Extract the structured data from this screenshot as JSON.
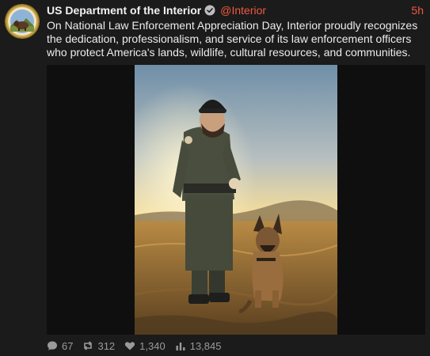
{
  "post": {
    "author_name": "US Department of the Interior",
    "handle": "@Interior",
    "time": "5h",
    "text": "On National Law Enforcement Appreciation Day, Interior proudly recognizes the dedication, professionalism, and service of its law enforcement officers who protect America's lands, wildlife, cultural resources, and communities.",
    "avatar_icon": "bison-seal-icon",
    "image_description_icon": "officer-with-dog-photo"
  },
  "stats": {
    "replies": "67",
    "reposts": "312",
    "likes": "1,340",
    "views": "13,845"
  },
  "colors": {
    "background": "#1b1b1b",
    "accent": "#f0593f",
    "text": "#ececec",
    "muted": "#9a9a9a"
  }
}
